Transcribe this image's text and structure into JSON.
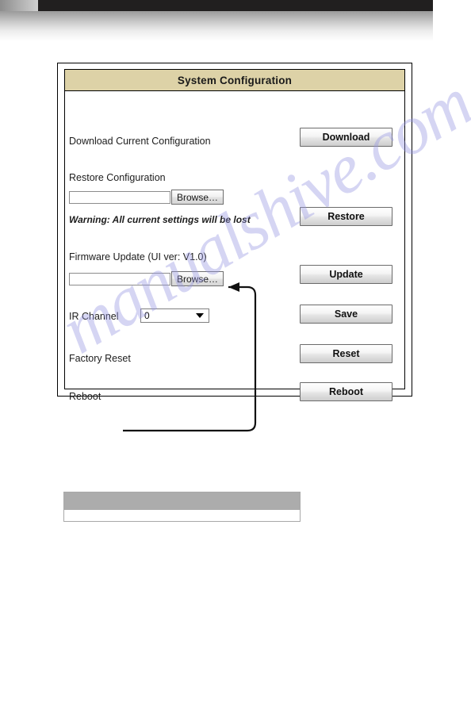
{
  "panel": {
    "title": "System Configuration",
    "rows": [
      {
        "label": "Download Current Configuration",
        "button": "Download"
      },
      {
        "label": "Restore Configuration",
        "browse": "Browse…",
        "input_value": "",
        "button": "Restore"
      },
      {
        "label": "Warning: All current settings will be lost"
      },
      {
        "label": "Firmware Update (UI ver: V1.0)",
        "browse": "Browse…",
        "input_value": "",
        "button": "Update"
      },
      {
        "label": "IR Channel",
        "select_value": "0",
        "button": "Save"
      },
      {
        "label": "Factory Reset",
        "button": "Reset"
      },
      {
        "label": "Reboot",
        "button": "Reboot"
      }
    ],
    "buttons": {
      "download": "Download",
      "restore": "Restore",
      "update": "Update",
      "save": "Save",
      "reset": "Reset",
      "reboot": "Reboot"
    },
    "browse_label": "Browse…",
    "ir_channel_value": "0",
    "ir_channel_options": [
      "0"
    ],
    "restore_input_value": "",
    "firmware_input_value": "",
    "colors": {
      "title_bar": "#ddd2a7",
      "panel_border": "#000000",
      "button_face": "#e6e6e6",
      "table_header": "#acacac"
    }
  },
  "watermark": {
    "text": "manualshive.com"
  }
}
